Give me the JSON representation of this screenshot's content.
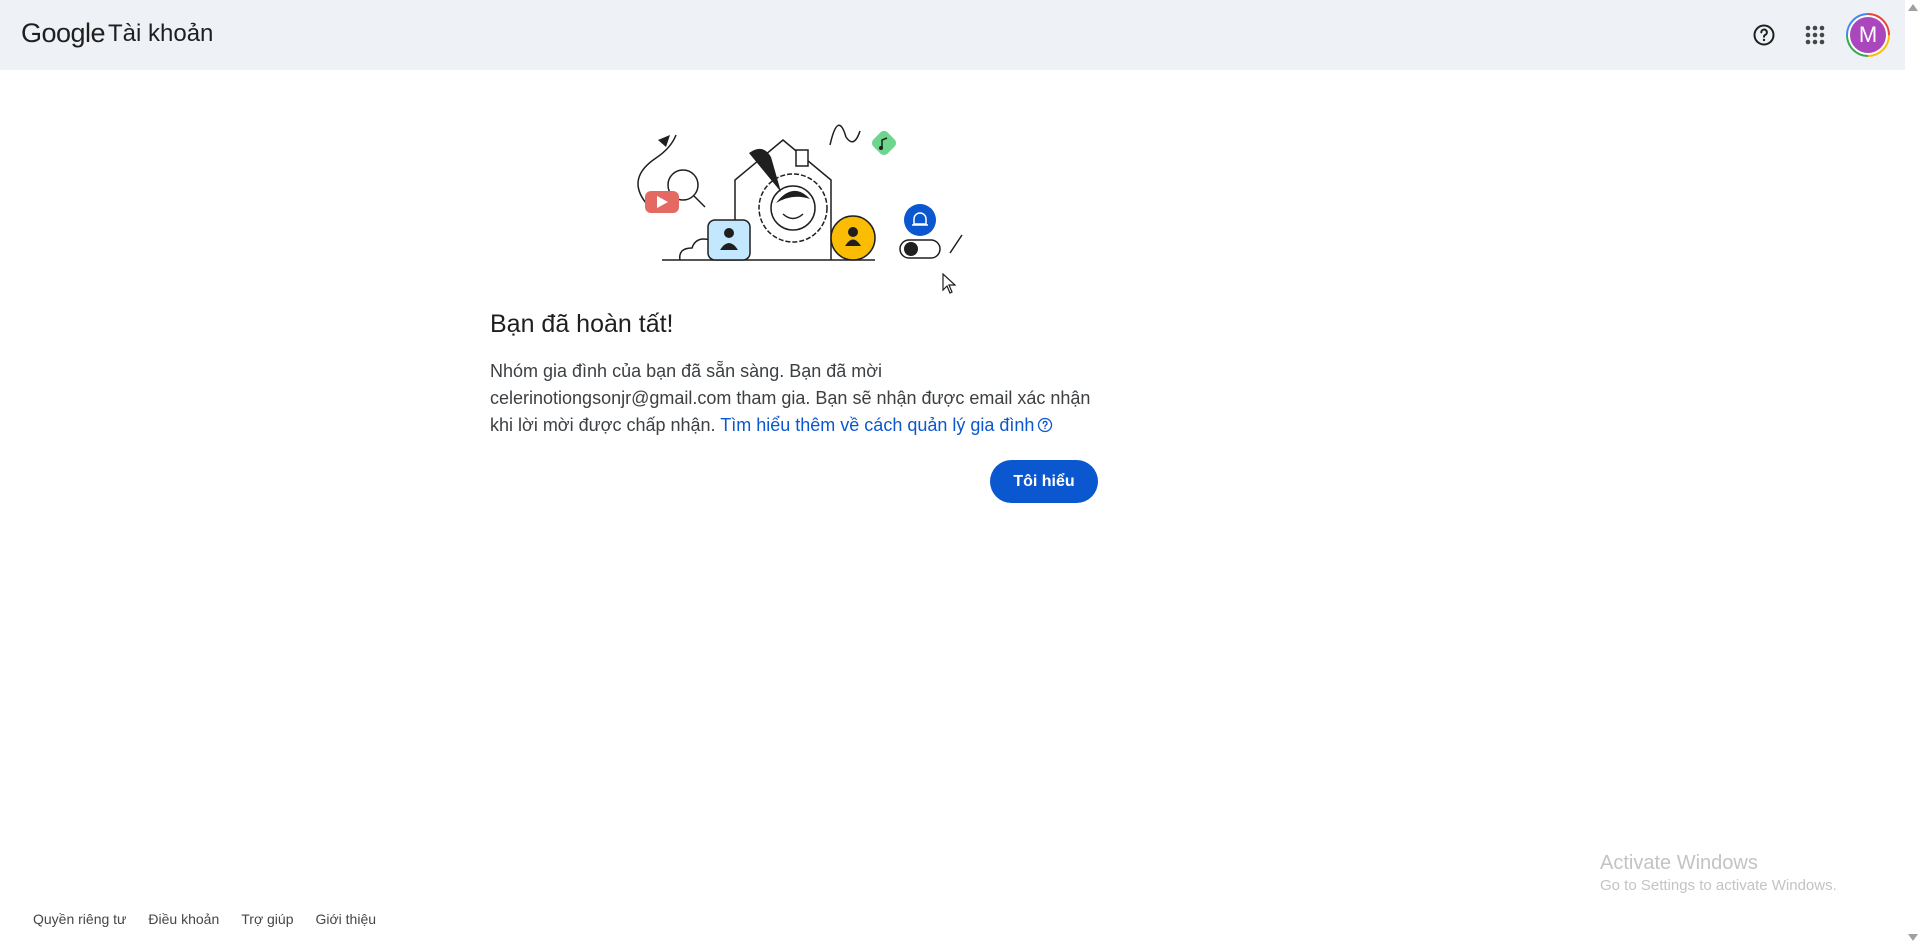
{
  "header": {
    "logo_google": "Google",
    "logo_product": "Tài khoản",
    "help_icon": "help-circle-icon",
    "apps_icon": "apps-grid-icon",
    "avatar_initial": "M"
  },
  "main": {
    "title": "Bạn đã hoàn tất!",
    "body_line1": "Nhóm gia đình của bạn đã sẵn sàng. Bạn đã mời",
    "body_line2": "celerinotiongsonjr@gmail.com tham gia. Bạn sẽ nhận được email xác nhận",
    "body_line3": "khi lời mời được chấp nhận.",
    "learn_more_link": "Tìm hiểu thêm về cách quản lý gia đình",
    "confirm_button": "Tôi hiểu"
  },
  "watermark": {
    "line1": "Activate Windows",
    "line2": "Go to Settings to activate Windows."
  },
  "footer": {
    "links": [
      "Quyền riêng tư",
      "Điều khoản",
      "Trợ giúp",
      "Giới thiệu"
    ]
  },
  "colors": {
    "accent": "#0b57d0",
    "header_bg": "#eef1f6",
    "avatar_bg": "#ab47bc"
  }
}
